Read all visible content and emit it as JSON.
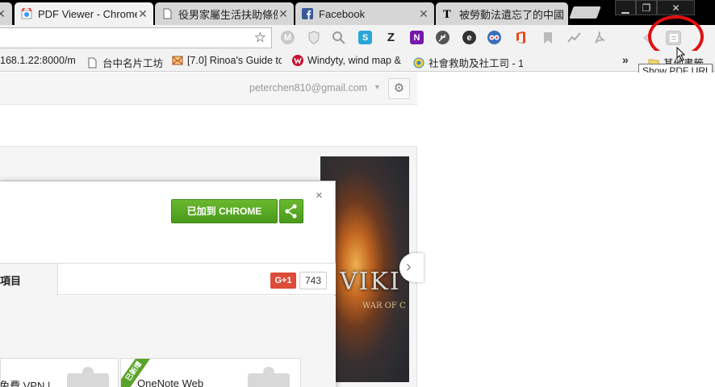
{
  "tabs": [
    {
      "title": "PDF Viewer - Chrome"
    },
    {
      "title": "役男家屬生活扶助條例"
    },
    {
      "title": "Facebook"
    },
    {
      "title": "被勞動法遺忘了的中國"
    }
  ],
  "window": {
    "minimize": "▁",
    "maximize": "❐",
    "close": "✕"
  },
  "toolbar": {
    "star_icon": "star-icon",
    "extensions": [
      "m-icon",
      "shield-icon",
      "search-icon",
      "s-icon",
      "z-icon",
      "onenote-icon",
      "feather-icon",
      "e-icon",
      "owl-icon",
      "office-icon",
      "bookmark-icon",
      "pulse-icon",
      "pdf-icon",
      "plug-icon",
      "show-pdf-url-icon"
    ],
    "ext_labels": {
      "m": "M",
      "z": "Z",
      "s": "S",
      "n": "N",
      "e": "e"
    }
  },
  "bookmarks": [
    {
      "label": "168.1.22:8000/m"
    },
    {
      "label": "台中名片工坊"
    },
    {
      "label": "[7.0] Rinoa's Guide to"
    },
    {
      "label": "Windyty, wind map &"
    },
    {
      "label": "社會救助及社工司 - 1"
    },
    {
      "label": "其他書籤"
    }
  ],
  "bookmarks_overflow": "»",
  "tooltip": "Show PDF URL",
  "store": {
    "account_email": "peterchen810@gmail.com",
    "banner": {
      "title": "VIKI",
      "subtitle": "WAR OF C"
    },
    "dialog": {
      "added_label": "已加到 CHROME",
      "close_label": "×",
      "tab_details": "詳細項目",
      "gplus_label": "G+1",
      "gplus_count": "743",
      "cards": [
        {
          "title": "免費 VPN |"
        },
        {
          "ribbon": "已新增",
          "title": "OneNote Web"
        }
      ]
    }
  },
  "colors": {
    "accent_green": "#4a9a1c",
    "highlight": "#e01010",
    "gplus": "#dd4b39"
  }
}
